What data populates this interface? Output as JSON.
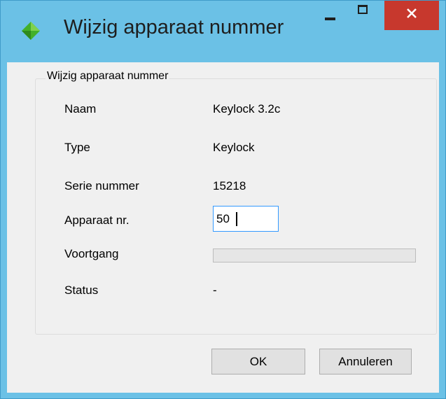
{
  "window": {
    "title": "Wijzig apparaat nummer",
    "accent_color": "#6bc1e6",
    "icon": "green-diamond-icon",
    "controls": {
      "minimize": "minimize-icon",
      "maximize": "maximize-icon",
      "close": "close-icon",
      "close_color": "#c7382d"
    }
  },
  "group": {
    "label": "Wijzig apparaat nummer"
  },
  "fields": {
    "naam": {
      "label": "Naam",
      "value": "Keylock 3.2c"
    },
    "type": {
      "label": "Type",
      "value": "Keylock"
    },
    "serie": {
      "label": "Serie nummer",
      "value": "15218"
    },
    "apparaat": {
      "label": "Apparaat nr.",
      "value": "50"
    },
    "voortgang": {
      "label": "Voortgang",
      "progress_percent": 0
    },
    "status": {
      "label": "Status",
      "value": "-"
    }
  },
  "buttons": {
    "ok": "OK",
    "cancel": "Annuleren"
  }
}
